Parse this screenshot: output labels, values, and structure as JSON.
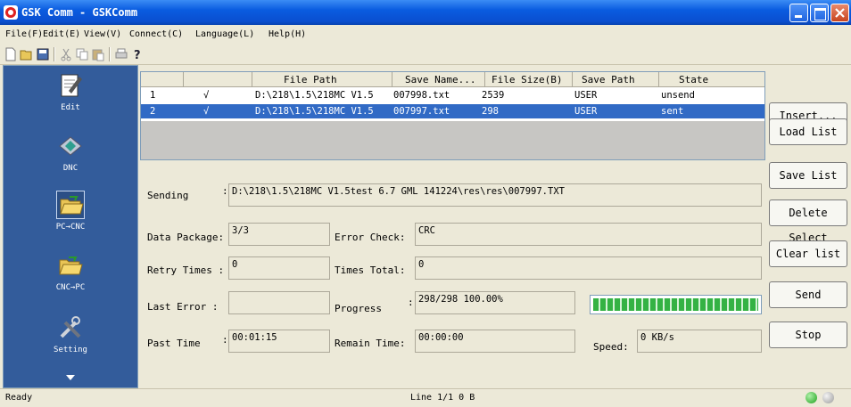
{
  "window": {
    "title": "GSK Comm - GSKComm"
  },
  "menu": [
    "File(F)",
    "Edit(E)",
    "View(V)",
    "Connect(C)",
    "Language(L)",
    "Help(H)"
  ],
  "toolbar": {
    "icons": [
      "new-icon",
      "open-icon",
      "save-icon",
      "cut-icon",
      "copy-icon",
      "paste-icon",
      "print-icon",
      "help-icon"
    ]
  },
  "sidebar": {
    "items": [
      {
        "label": "Edit",
        "icon": "edit-icon"
      },
      {
        "label": "DNC",
        "icon": "dnc-icon"
      },
      {
        "label": "PC→CNC",
        "icon": "folder-open-icon",
        "selected": true
      },
      {
        "label": "CNC→PC",
        "icon": "folder-open-icon"
      },
      {
        "label": "Setting",
        "icon": "tools-icon"
      }
    ]
  },
  "table": {
    "headers": [
      "File Path",
      "Save Name...",
      "File Size(B)",
      "Save Path",
      "State"
    ],
    "rows": [
      {
        "index": "1",
        "check": "√",
        "path": "D:\\218\\1.5\\218MC V1.5",
        "save_name": "007998.txt",
        "size": "2539",
        "save_path": "USER",
        "state": "unsend"
      },
      {
        "index": "2",
        "check": "√",
        "path": "D:\\218\\1.5\\218MC V1.5",
        "save_name": "007997.txt",
        "size": "298",
        "save_path": "USER",
        "state": "sent"
      }
    ]
  },
  "buttons": {
    "insert": "Insert...",
    "load": "Load List",
    "save": "Save List",
    "delete": "Delete Select",
    "clear": "Clear list",
    "send": "Send",
    "stop": "Stop"
  },
  "status_panel": {
    "sending_label": "Sending",
    "sending_value": "D:\\218\\1.5\\218MC V1.5test 6.7 GML 141224\\res\\res\\007997.TXT",
    "data_package_label": "Data Package:",
    "data_package_value": "3/3",
    "error_check_label": "Error Check:",
    "error_check_value": "CRC",
    "retry_label": "Retry Times :",
    "retry_value": "0",
    "times_total_label": "Times Total:",
    "times_total_value": "0",
    "last_error_label": "Last Error  :",
    "last_error_value": "",
    "progress_label": "Progress",
    "progress_value": "298/298   100.00%",
    "progress_fraction": 1.0,
    "past_time_label": "Past Time",
    "past_time_value": "00:01:15",
    "remain_time_label": "Remain Time:",
    "remain_time_value": "00:00:00",
    "speed_label": "Speed:",
    "speed_value": "0 KB/s"
  },
  "statusbar": {
    "left": "Ready",
    "middle": "Line 1/1   0 B"
  },
  "colors": {
    "title_blue": "#0a5ce0",
    "sidebar_blue": "#335c9b",
    "selection_blue": "#316ac5",
    "progress_green": "#34b244"
  }
}
